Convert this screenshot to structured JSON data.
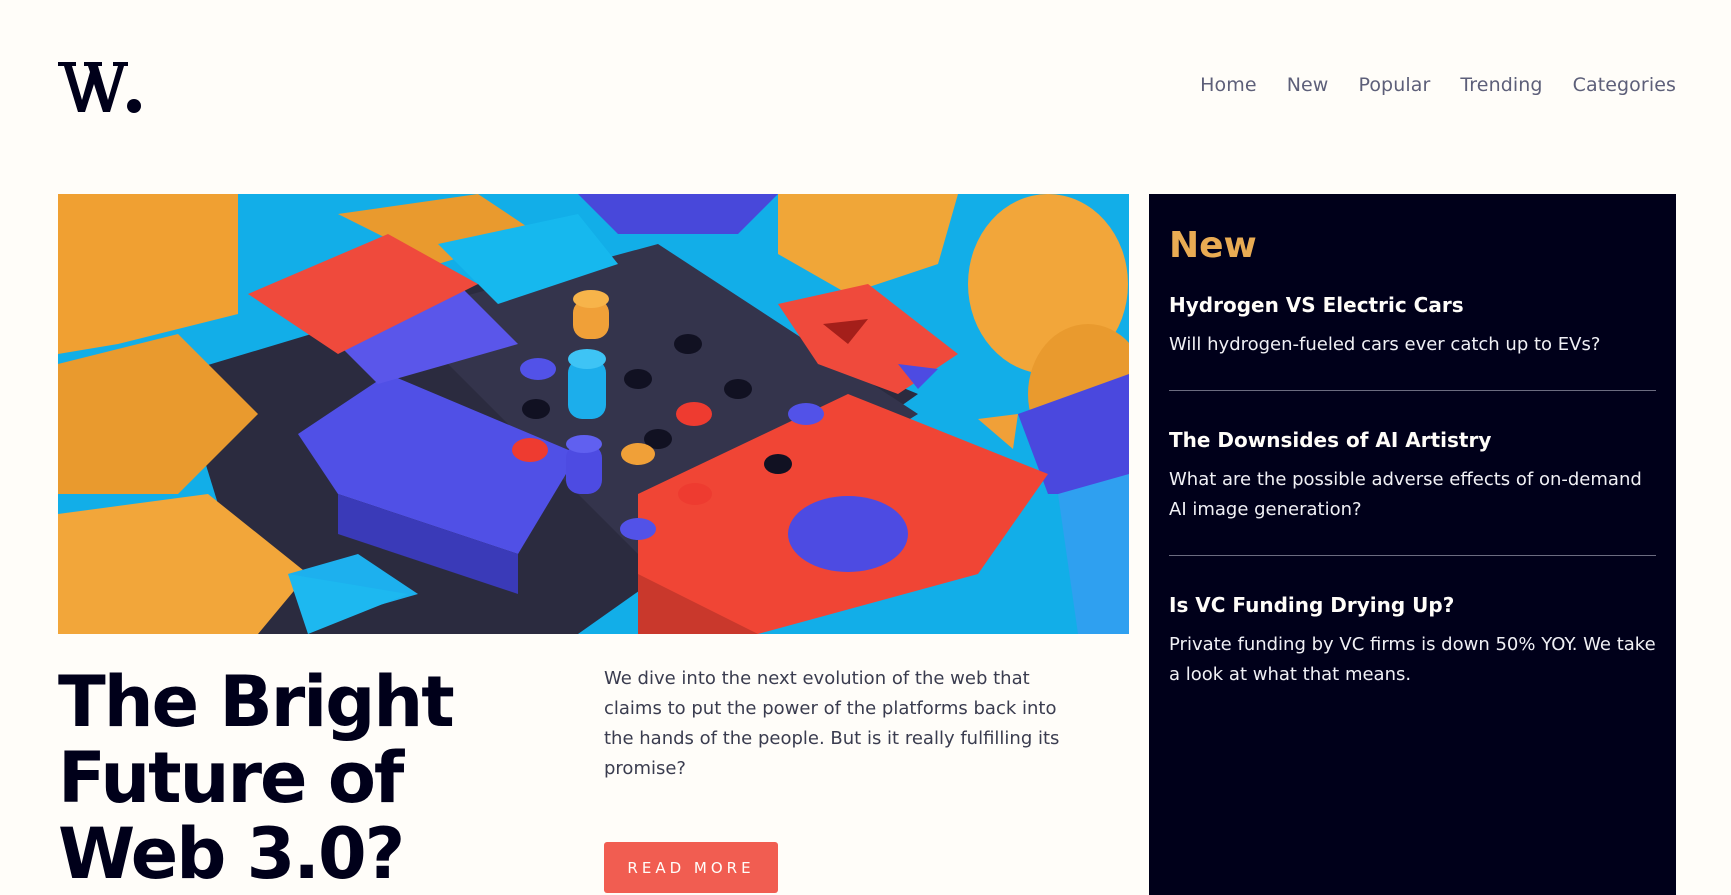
{
  "brand": {
    "logo_text": "W."
  },
  "nav": {
    "items": [
      "Home",
      "New",
      "Popular",
      "Trending",
      "Categories"
    ]
  },
  "hero": {
    "title": "The Bright Future of Web 3.0?",
    "description": "We dive into the next evolution of the web that claims to put the power of the platforms back into the hands of the people. But is it really fulfilling its promise?",
    "button_label": "READ MORE",
    "image_alt": "Colorful 3D geometric blocks"
  },
  "new_panel": {
    "title": "New",
    "items": [
      {
        "title": "Hydrogen VS Electric Cars",
        "text": "Will hydrogen-fueled cars ever catch up to EVs?"
      },
      {
        "title": "The Downsides of AI Artistry",
        "text": "What are the possible adverse effects of on-demand AI image generation?"
      },
      {
        "title": "Is VC Funding Drying Up?",
        "text": "Private funding by VC firms is down 50% YOY. We take a look at what that means."
      }
    ]
  },
  "colors": {
    "background": "#fffdf9",
    "dark": "#00001a",
    "accent_orange": "#e9ab53",
    "accent_red": "#f15d51",
    "nav_text": "#5d5f79"
  }
}
